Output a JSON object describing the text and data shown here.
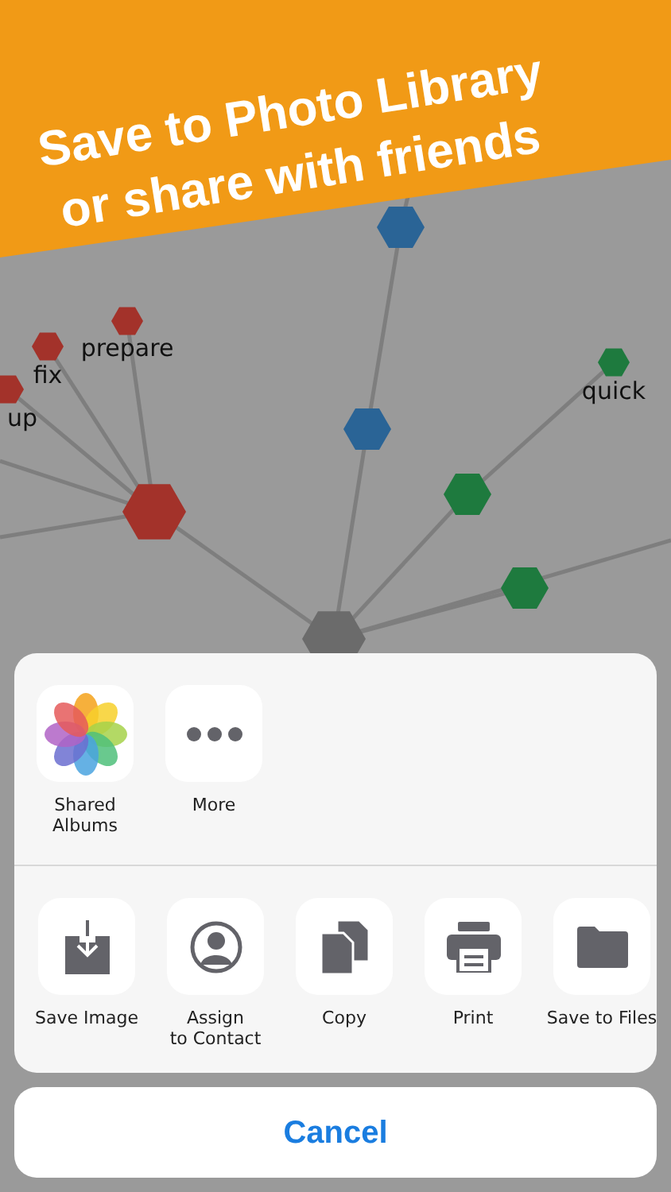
{
  "banner": {
    "lines": [
      "Save to Photo Library",
      "or share with friends"
    ]
  },
  "graph": {
    "nodes": [
      {
        "color": "#6b6b6b"
      },
      {
        "color": "#2a6496"
      },
      {
        "color": "#2a6496"
      },
      {
        "color": "#1e7a3e"
      },
      {
        "color": "#1e7a3e"
      },
      {
        "color": "#1e7a3e",
        "label": "quick"
      },
      {
        "color": "#a3322a"
      },
      {
        "color": "#a3322a",
        "label": "prepare"
      },
      {
        "color": "#a3322a",
        "label": "fix"
      },
      {
        "color": "#a3322a",
        "label": "up"
      }
    ]
  },
  "share_sheet": {
    "apps": [
      {
        "kind": "photos",
        "lines": [
          "Shared",
          "Albums"
        ]
      },
      {
        "kind": "more",
        "lines": [
          "More"
        ]
      }
    ],
    "actions": [
      {
        "kind": "save",
        "lines": [
          "Save Image"
        ]
      },
      {
        "kind": "contact",
        "lines": [
          "Assign",
          "to Contact"
        ]
      },
      {
        "kind": "copy",
        "lines": [
          "Copy"
        ]
      },
      {
        "kind": "print",
        "lines": [
          "Print"
        ]
      },
      {
        "kind": "files",
        "lines": [
          "Save to Files"
        ]
      }
    ]
  },
  "cancel_button": "Cancel"
}
